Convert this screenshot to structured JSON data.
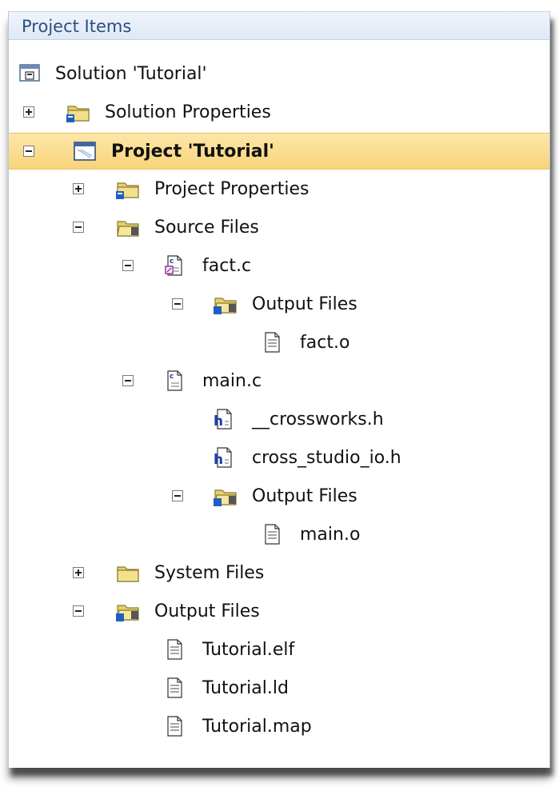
{
  "header": {
    "title": "Project Items"
  },
  "tree": {
    "solution": {
      "label": "Solution 'Tutorial'"
    },
    "solution_properties": {
      "label": "Solution Properties"
    },
    "project": {
      "label": "Project 'Tutorial'"
    },
    "project_properties": {
      "label": "Project Properties"
    },
    "source_files": {
      "label": "Source Files"
    },
    "fact_c": {
      "label": "fact.c"
    },
    "fact_output_files": {
      "label": "Output Files"
    },
    "fact_o": {
      "label": "fact.o"
    },
    "main_c": {
      "label": "main.c"
    },
    "crossworks_h": {
      "label": "__crossworks.h"
    },
    "cross_studio_io_h": {
      "label": "cross_studio_io.h"
    },
    "main_output_files": {
      "label": "Output Files"
    },
    "main_o": {
      "label": "main.o"
    },
    "system_files": {
      "label": "System Files"
    },
    "output_files": {
      "label": "Output Files"
    },
    "tutorial_elf": {
      "label": "Tutorial.elf"
    },
    "tutorial_ld": {
      "label": "Tutorial.ld"
    },
    "tutorial_map": {
      "label": "Tutorial.map"
    }
  },
  "colors": {
    "header_text": "#2b4e7e",
    "selection": "#f8d37a",
    "folder": "#e8cf6a"
  }
}
